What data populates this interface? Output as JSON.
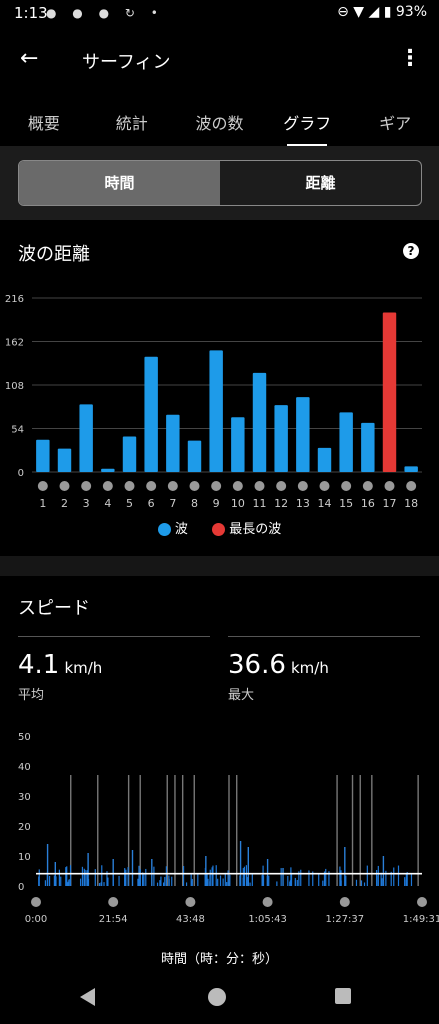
{
  "status_bar": {
    "time": "1:13",
    "battery": "93%"
  },
  "app_bar": {
    "title": "サーフィン"
  },
  "tabs": [
    "概要",
    "統計",
    "波の数",
    "グラフ",
    "ギア"
  ],
  "active_tab": 3,
  "toggle": {
    "left": "時間",
    "right": "距離",
    "selected": "left"
  },
  "wave_section": {
    "title": "波の距離",
    "legend": {
      "wave": "波",
      "longest": "最長の波"
    },
    "colors": {
      "wave": "#1e9be9",
      "longest": "#e53935"
    }
  },
  "speed_section": {
    "title": "スピード",
    "avg": {
      "value": "4.1",
      "unit": "km/h",
      "label": "平均"
    },
    "max": {
      "value": "36.6",
      "unit": "km/h",
      "label": "最大"
    },
    "xaxis_title": "時間（時：分：秒）"
  },
  "chart_data": [
    {
      "type": "bar",
      "title": "波の距離",
      "categories": [
        "1",
        "2",
        "3",
        "4",
        "5",
        "6",
        "7",
        "8",
        "9",
        "10",
        "11",
        "12",
        "13",
        "14",
        "15",
        "16",
        "17",
        "18"
      ],
      "values": [
        40,
        29,
        84,
        4,
        44,
        143,
        71,
        39,
        151,
        68,
        123,
        83,
        93,
        30,
        74,
        61,
        198,
        7
      ],
      "highlight_index": 16,
      "yticks": [
        0,
        54,
        108,
        162,
        216
      ],
      "ylim": [
        0,
        216
      ],
      "grid": true,
      "legend": [
        "波",
        "最長の波"
      ]
    },
    {
      "type": "area",
      "title": "スピード",
      "xlabel": "時間（時：分：秒）",
      "xticks": [
        "0:00",
        "21:54",
        "43:48",
        "1:05:43",
        "1:27:37",
        "1:49:31"
      ],
      "yticks": [
        0,
        10,
        20,
        30,
        40,
        50
      ],
      "ylim": [
        0,
        50
      ],
      "average": 4.1,
      "max": 36.6,
      "spikes": [
        {
          "x": 0.03,
          "y": 14
        },
        {
          "x": 0.05,
          "y": 8
        },
        {
          "x": 0.09,
          "y": 37
        },
        {
          "x": 0.135,
          "y": 11
        },
        {
          "x": 0.16,
          "y": 37
        },
        {
          "x": 0.2,
          "y": 9
        },
        {
          "x": 0.24,
          "y": 37
        },
        {
          "x": 0.25,
          "y": 12
        },
        {
          "x": 0.27,
          "y": 37
        },
        {
          "x": 0.3,
          "y": 9
        },
        {
          "x": 0.34,
          "y": 37
        },
        {
          "x": 0.36,
          "y": 37
        },
        {
          "x": 0.38,
          "y": 37
        },
        {
          "x": 0.41,
          "y": 37
        },
        {
          "x": 0.44,
          "y": 10
        },
        {
          "x": 0.5,
          "y": 37
        },
        {
          "x": 0.52,
          "y": 37
        },
        {
          "x": 0.53,
          "y": 15
        },
        {
          "x": 0.55,
          "y": 13
        },
        {
          "x": 0.6,
          "y": 9
        },
        {
          "x": 0.64,
          "y": 6
        },
        {
          "x": 0.78,
          "y": 37
        },
        {
          "x": 0.8,
          "y": 13
        },
        {
          "x": 0.82,
          "y": 37
        },
        {
          "x": 0.84,
          "y": 37
        },
        {
          "x": 0.87,
          "y": 37
        },
        {
          "x": 0.9,
          "y": 10
        },
        {
          "x": 0.99,
          "y": 37
        }
      ]
    }
  ]
}
